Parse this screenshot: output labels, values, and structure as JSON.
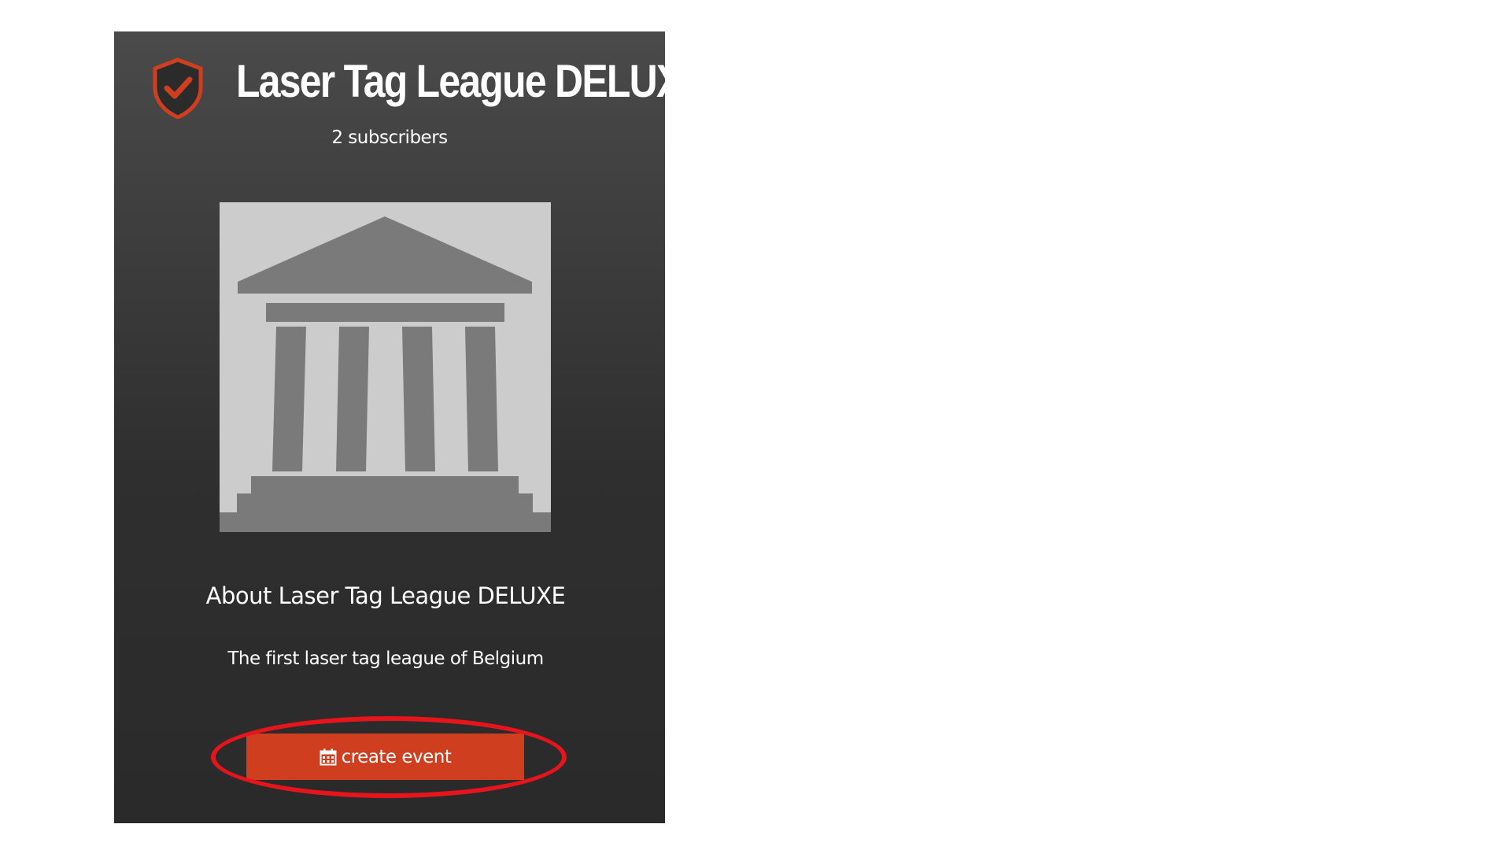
{
  "league": {
    "name": "Laser Tag League DELUXE",
    "subscribers": "2 subscribers",
    "about_heading": "About Laser Tag League DELUXE",
    "description": "The first laser tag league of Belgium"
  },
  "actions": {
    "create_event_label": "create event",
    "create_event_icon": "calendar-icon"
  },
  "icons": {
    "logo": "shield-check-icon",
    "image_placeholder": "building-columns-icon"
  },
  "colors": {
    "panel_top": "#4a4a4a",
    "panel_bottom": "#2a2a2a",
    "accent": "#cf3e1e",
    "highlight": "#e8141c",
    "placeholder_bg": "#cccccc",
    "placeholder_fg": "#7a7a7a"
  }
}
